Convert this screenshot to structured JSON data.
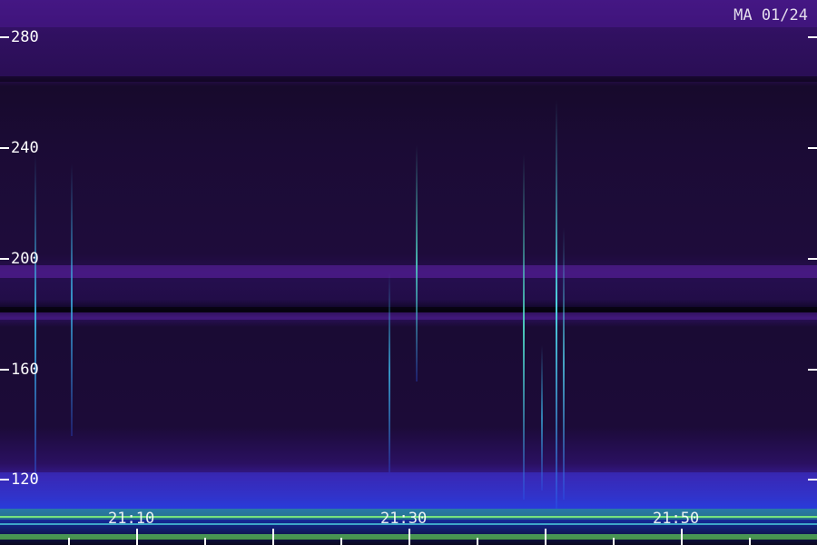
{
  "station_label": "MA 01/24",
  "y_axis": {
    "ticks": [
      {
        "label": "280",
        "value": 280
      },
      {
        "label": "240",
        "value": 240
      },
      {
        "label": "200",
        "value": 200
      },
      {
        "label": "160",
        "value": 160
      },
      {
        "label": "120",
        "value": 120
      }
    ]
  },
  "x_axis": {
    "ticks": [
      {
        "label": "21:10"
      },
      {
        "label": "21:30"
      },
      {
        "label": "21:50"
      }
    ]
  },
  "colors": {
    "background": "#140a26",
    "noise_purple": "#3a1470",
    "mid_blue": "#2a2bb0",
    "bright_blue": "#1a3ad0",
    "cyan": "#3fd0e0",
    "green": "#7dff60",
    "axis": "#ffffff"
  }
}
